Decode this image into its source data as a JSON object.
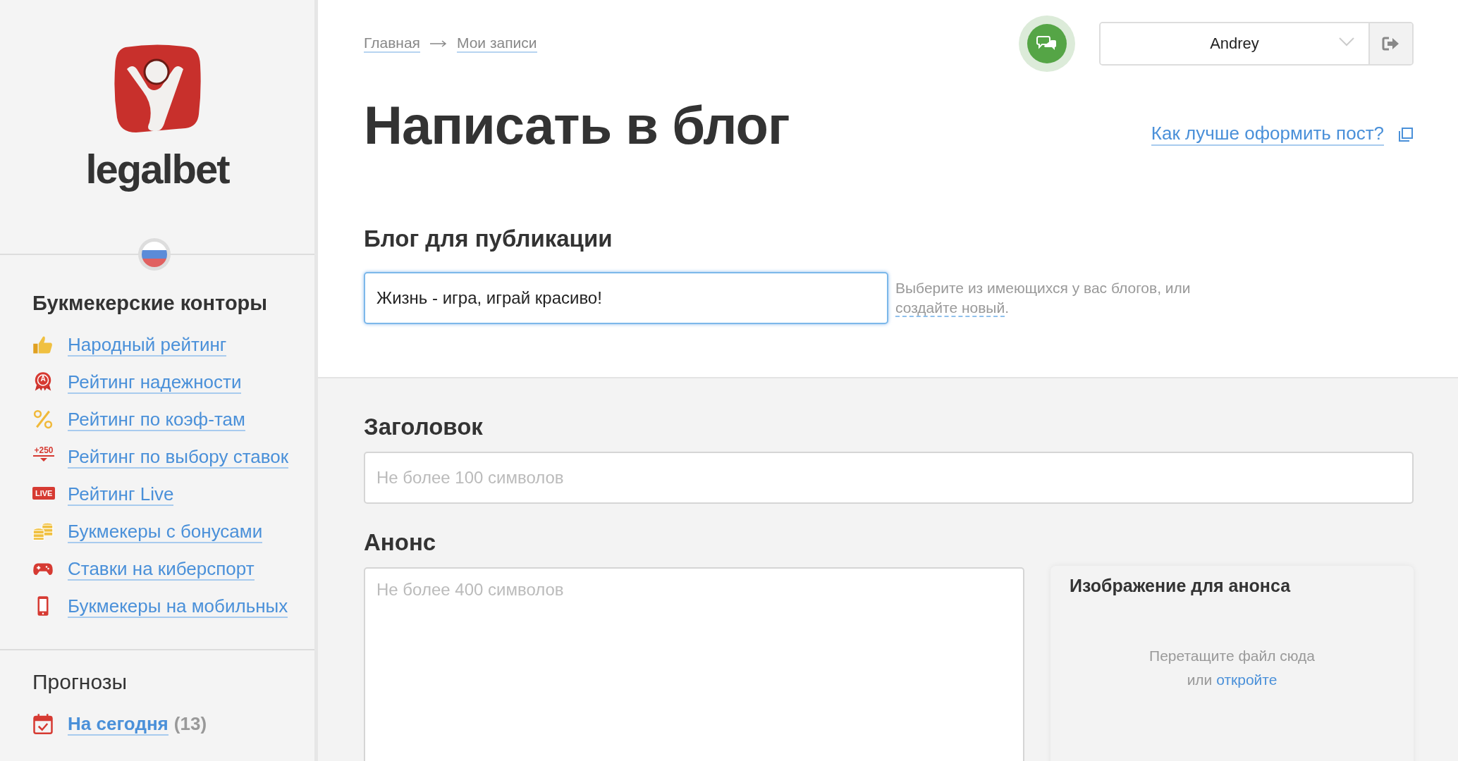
{
  "sidebar": {
    "logo": "legalbet",
    "sections": [
      {
        "title": "Букмекерские конторы",
        "items": [
          {
            "label": "Народный рейтинг"
          },
          {
            "label": "Рейтинг надежности",
            "badge": "A"
          },
          {
            "label": "Рейтинг по коэф-там"
          },
          {
            "label": "Рейтинг по выбору ставок",
            "badge": "+250"
          },
          {
            "label": "Рейтинг Live",
            "badge": "LIVE"
          },
          {
            "label": "Букмекеры с бонусами"
          },
          {
            "label": "Ставки на киберспорт"
          },
          {
            "label": "Букмекеры на мобильных"
          }
        ]
      },
      {
        "title": "Прогнозы",
        "items": [
          {
            "label": "На сегодня",
            "count": "(13)"
          }
        ]
      }
    ]
  },
  "header": {
    "breadcrumbs": [
      "Главная",
      "Мои записи"
    ],
    "user": "Andrey"
  },
  "title": "Написать в блог",
  "help_link": "Как лучше оформить пост?",
  "blog": {
    "label": "Блог для публикации",
    "value": "Жизнь - игра, играй красиво!",
    "focused": true,
    "hint": "Выберите из имеющихся у вас блогов, или",
    "hint_link": "создайте новый",
    "hint_end": "."
  },
  "headline": {
    "label": "Заголовок",
    "placeholder": "Не более 100 символов"
  },
  "announce": {
    "label": "Анонс",
    "placeholder": "Не более 400 символов"
  },
  "image": {
    "title": "Изображение для анонса",
    "drop_text": "Перетащите файл сюда",
    "or": "или",
    "open_link": "откройте"
  }
}
